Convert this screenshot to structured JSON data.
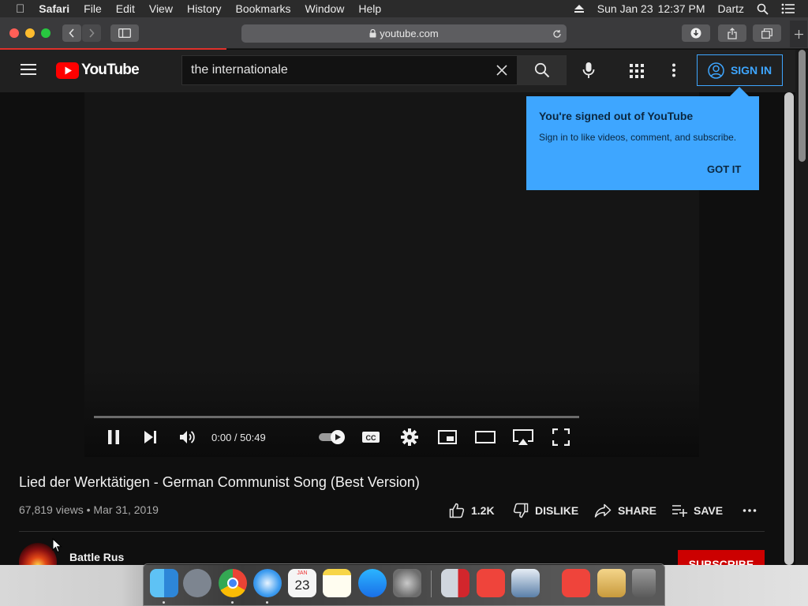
{
  "menubar": {
    "apple_icon": "apple-icon",
    "app_name": "Safari",
    "items": [
      "File",
      "Edit",
      "View",
      "History",
      "Bookmarks",
      "Window",
      "Help"
    ],
    "date": "Sun Jan 23",
    "time": "12:37 PM",
    "user": "Dartz"
  },
  "safari": {
    "url": "youtube.com",
    "progress_fraction": 0.28
  },
  "youtube": {
    "logo_text": "YouTube",
    "search_query": "the internationale",
    "signin_label": "SIGN IN",
    "popup": {
      "title": "You're signed out of YouTube",
      "body": "Sign in to like videos, comment, and subscribe.",
      "button": "GOT IT"
    },
    "player": {
      "timecode": "0:00 / 50:49",
      "played_fraction": 0.0,
      "autoplay_on": true
    },
    "video": {
      "title": "Lied der Werktätigen - German Communist Song (Best Version)",
      "views": "67,819 views",
      "date": "Mar 31, 2019",
      "likes": "1.2K",
      "dislike_label": "DISLIKE",
      "share_label": "SHARE",
      "save_label": "SAVE"
    },
    "channel": {
      "name": "Battle Rus",
      "subscribe_label": "SUBSCRIBE"
    }
  },
  "dock": {
    "calendar_month": "JAN",
    "calendar_day": "23",
    "apps": [
      "Finder",
      "Launchpad",
      "Chrome",
      "Safari",
      "Calendar",
      "Notes",
      "App Store",
      "System Preferences",
      "Parallels",
      "AnyDesk",
      "VirtualBox",
      "AnyDesk",
      "Archive Utility",
      "Trash"
    ]
  },
  "colors": {
    "accent_blue": "#3ea6ff",
    "youtube_red": "#ff0000",
    "subscribe_red": "#cc0000"
  }
}
